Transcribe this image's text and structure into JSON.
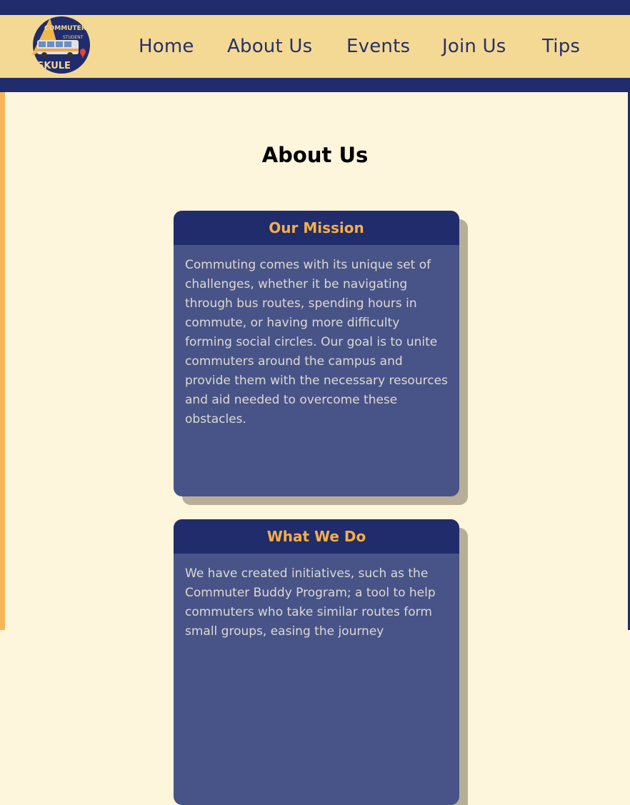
{
  "header": {
    "logo": {
      "alt": "Commuter Student Skule logo",
      "text_top": "COMMUTER",
      "text_mid": "STUDENT",
      "text_bottom": "SKULE"
    },
    "nav": [
      {
        "label": "Home"
      },
      {
        "label": "About Us"
      },
      {
        "label": "Events"
      },
      {
        "label": "Join Us"
      },
      {
        "label": "Tips"
      }
    ]
  },
  "main": {
    "title": "About Us",
    "cards": [
      {
        "title": "Our Mission",
        "body": "Commuting comes with its unique set of challenges, whether it be navigating through bus routes, spending hours in commute, or having more difficulty forming social circles. Our goal is to unite commuters around the campus and provide them with the necessary resources and aid needed to overcome these obstacles."
      },
      {
        "title": "What We Do",
        "body": "We have created initiatives, such as the Commuter Buddy Program; a tool to help commuters who take similar routes form small groups, easing the journey"
      }
    ]
  },
  "colors": {
    "navy": "#202c6b",
    "nav_bg": "#f4d994",
    "page_bg": "#fef5dd",
    "card_bg": "#485487",
    "accent_orange": "#f5ae49",
    "card_shadow": "#b8ae97"
  }
}
